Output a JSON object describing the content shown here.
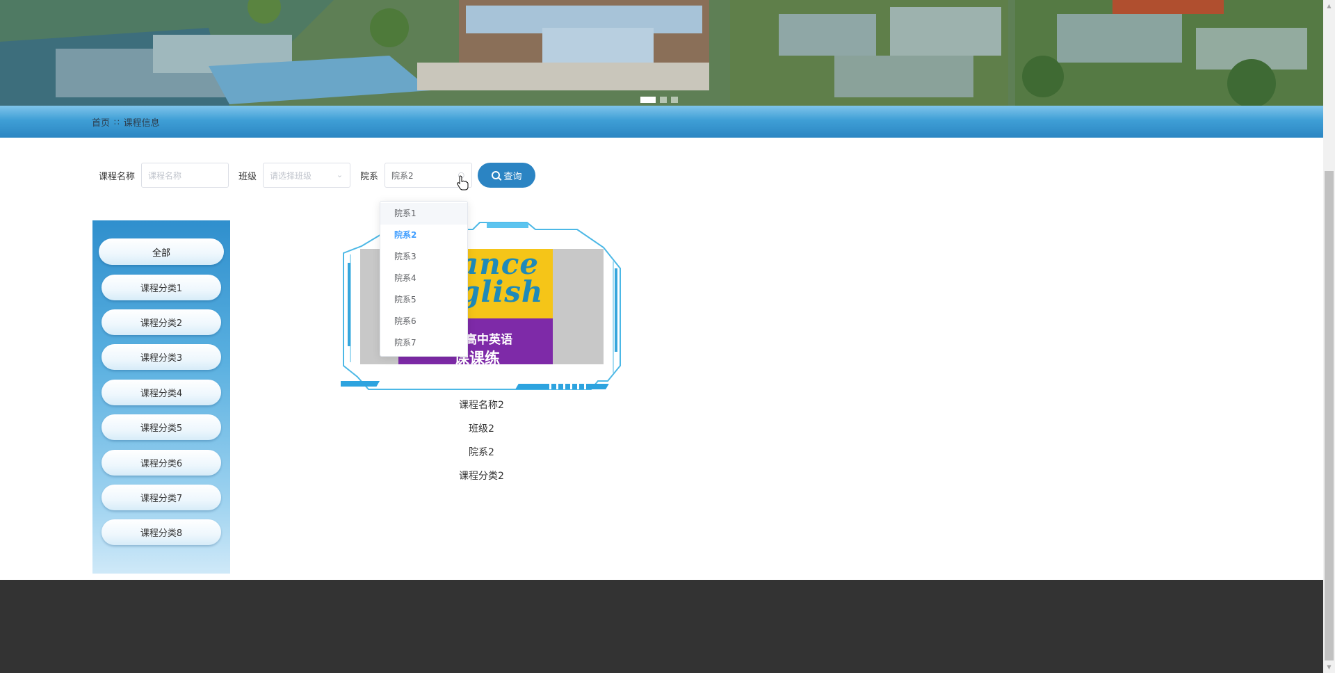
{
  "banner": {
    "slides": 3,
    "active_slide": 1
  },
  "breadcrumb": {
    "home": "首页",
    "separator": "∷",
    "current": "课程信息"
  },
  "search": {
    "name_label": "课程名称",
    "name_placeholder": "课程名称",
    "class_label": "班级",
    "class_placeholder": "请选择班级",
    "dept_label": "院系",
    "dept_value": "院系2",
    "button_label": "查询"
  },
  "dept_options": [
    "院系1",
    "院系2",
    "院系3",
    "院系4",
    "院系5",
    "院系6",
    "院系7"
  ],
  "categories": {
    "all": "全部",
    "items": [
      "课程分类1",
      "课程分类2",
      "课程分类3",
      "课程分类4",
      "课程分类5",
      "课程分类6",
      "课程分类7",
      "课程分类8"
    ]
  },
  "course": {
    "cover_text_en": "ance\nglish",
    "cover_text_cn1": "高中英语",
    "cover_text_cn2": "课课练",
    "name": "课程名称2",
    "class": "班级2",
    "dept": "院系2",
    "category": "课程分类2"
  },
  "colors": {
    "accent": "#2b84c3",
    "footer": "#333333",
    "dropdown_selected": "#409eff"
  }
}
